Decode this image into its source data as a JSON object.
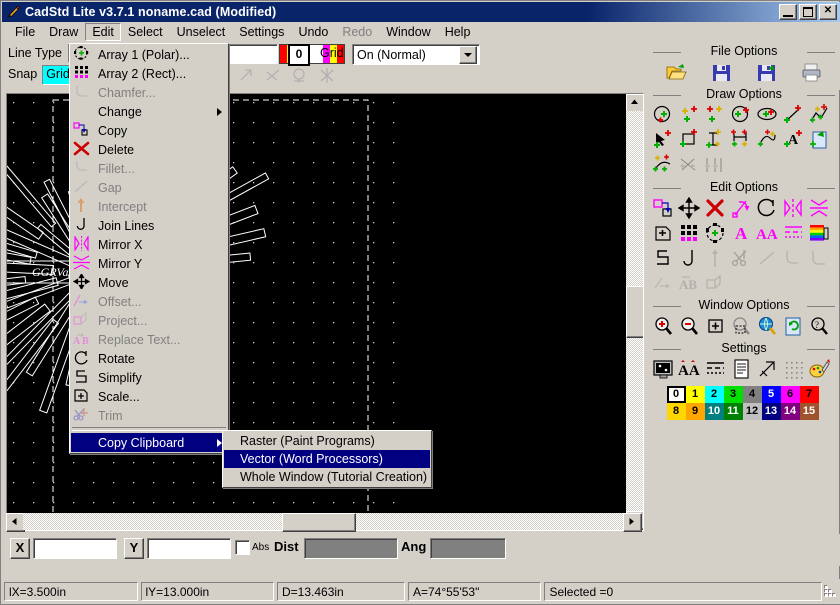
{
  "window": {
    "title": "CadStd Lite v3.7.1  noname.cad  (Modified)",
    "icon": "pencil-icon",
    "minimize_label": "_",
    "maximize_label": "",
    "close_label": "✕"
  },
  "menubar": {
    "items": [
      {
        "label": "File",
        "state": "normal"
      },
      {
        "label": "Draw",
        "state": "normal"
      },
      {
        "label": "Edit",
        "state": "active"
      },
      {
        "label": "Select",
        "state": "normal"
      },
      {
        "label": "Unselect",
        "state": "normal"
      },
      {
        "label": "Settings",
        "state": "normal"
      },
      {
        "label": "Undo",
        "state": "normal"
      },
      {
        "label": "Redo",
        "state": "disabled"
      },
      {
        "label": "Window",
        "state": "normal"
      },
      {
        "label": "Help",
        "state": "normal"
      }
    ]
  },
  "toolbar": {
    "line_type_label": "Line Type",
    "line_type_value": "",
    "snap_label": "Snap",
    "snap_value": "Grid",
    "width_value": "",
    "color_index": "0",
    "grid_label": "Grid",
    "grid_value": "On (Normal)"
  },
  "edit_menu": {
    "items": [
      {
        "label": "Array 1 (Polar)...",
        "icon": "array-polar-icon",
        "state": "normal"
      },
      {
        "label": "Array 2 (Rect)...",
        "icon": "array-rect-icon",
        "state": "normal"
      },
      {
        "label": "Chamfer...",
        "icon": "chamfer-icon",
        "state": "disabled"
      },
      {
        "label": "Change",
        "icon": "none",
        "state": "normal",
        "submenu": true
      },
      {
        "label": "Copy",
        "icon": "copy-icon",
        "state": "normal"
      },
      {
        "label": "Delete",
        "icon": "delete-icon",
        "state": "normal"
      },
      {
        "label": "Fillet...",
        "icon": "fillet-icon",
        "state": "disabled"
      },
      {
        "label": "Gap",
        "icon": "gap-icon",
        "state": "disabled"
      },
      {
        "label": "Intercept",
        "icon": "intercept-icon",
        "state": "disabled"
      },
      {
        "label": "Join Lines",
        "icon": "join-lines-icon",
        "state": "normal"
      },
      {
        "label": "Mirror X",
        "icon": "mirror-x-icon",
        "state": "normal"
      },
      {
        "label": "Mirror Y",
        "icon": "mirror-y-icon",
        "state": "normal"
      },
      {
        "label": "Move",
        "icon": "move-icon",
        "state": "normal"
      },
      {
        "label": "Offset...",
        "icon": "offset-icon",
        "state": "disabled"
      },
      {
        "label": "Project...",
        "icon": "project-icon",
        "state": "disabled"
      },
      {
        "label": "Replace Text...",
        "icon": "replace-text-icon",
        "state": "disabled"
      },
      {
        "label": "Rotate",
        "icon": "rotate-icon",
        "state": "normal"
      },
      {
        "label": "Simplify",
        "icon": "simplify-icon",
        "state": "normal"
      },
      {
        "label": "Scale...",
        "icon": "scale-icon",
        "state": "normal"
      },
      {
        "label": "Trim",
        "icon": "trim-icon",
        "state": "disabled"
      },
      {
        "label": "Copy Clipboard",
        "icon": "none",
        "state": "selected",
        "submenu": true
      }
    ]
  },
  "clipboard_submenu": {
    "items": [
      {
        "label": "Raster (Paint Programs)",
        "state": "normal"
      },
      {
        "label": "Vector (Word Processors)",
        "state": "selected"
      },
      {
        "label": "Whole Window (Tutorial Creation)",
        "state": "normal"
      }
    ]
  },
  "right_panel": {
    "file_options": {
      "title": "File Options",
      "icons": [
        "open-folder-icon",
        "save-icon",
        "save-as-icon",
        "print-icon"
      ]
    },
    "draw_options": {
      "title": "Draw Options",
      "icons": [
        "circle-center-icon",
        "arc-3point-icon",
        "arc-icon",
        "circle-2point-icon",
        "ellipse-icon",
        "line-icon",
        "polyline-icon",
        "pointer-icon",
        "rectangle-icon",
        "dimension-vertical-icon",
        "dimension-horizontal-icon",
        "spline-icon",
        "text-icon",
        "insert-file-icon",
        "curve-icon",
        "trim-draw-icon",
        "extend-draw-icon"
      ]
    },
    "edit_options": {
      "title": "Edit Options",
      "icons": [
        "copy-icon",
        "move-icon",
        "delete-icon",
        "rotate-node-icon",
        "rotate-icon",
        "mirror-x-icon",
        "mirror-y-icon",
        "scale-icon",
        "array-rect-icon",
        "array-polar-icon",
        "text-edit-icon",
        "replace-text-icon",
        "line-type-icon",
        "color-change-icon",
        "simplify-icon",
        "join-lines-icon",
        "intercept-icon",
        "trim-icon",
        "gap-icon",
        "fillet-icon",
        "chamfer-icon",
        "offset-icon",
        "replace-text2-icon",
        "project-icon"
      ]
    },
    "window_options": {
      "title": "Window Options",
      "icons": [
        "zoom-in-icon",
        "zoom-out-icon",
        "zoom-extents-icon",
        "zoom-window-icon",
        "zoom-all-icon",
        "redraw-icon",
        "zoom-help-icon"
      ]
    },
    "settings": {
      "title": "Settings",
      "icons": [
        "display-settings-icon",
        "text-settings-icon",
        "line-settings-icon",
        "page-settings-icon",
        "dimension-settings-icon",
        "grid-settings-icon",
        "color-settings-icon"
      ]
    },
    "palette": {
      "selected": "0",
      "cells": [
        {
          "n": "0",
          "hex": "#ffffff",
          "fg": "#000000"
        },
        {
          "n": "1",
          "hex": "#ffff00",
          "fg": "#000000"
        },
        {
          "n": "2",
          "hex": "#00ffff",
          "fg": "#000000"
        },
        {
          "n": "3",
          "hex": "#00e000",
          "fg": "#000000"
        },
        {
          "n": "4",
          "hex": "#808080",
          "fg": "#000000"
        },
        {
          "n": "5",
          "hex": "#0000ff",
          "fg": "#ffffff"
        },
        {
          "n": "6",
          "hex": "#ff00ff",
          "fg": "#000000"
        },
        {
          "n": "7",
          "hex": "#ff0000",
          "fg": "#000000"
        },
        {
          "n": "8",
          "hex": "#ffd700",
          "fg": "#000000"
        },
        {
          "n": "9",
          "hex": "#ffa500",
          "fg": "#000000"
        },
        {
          "n": "10",
          "hex": "#008080",
          "fg": "#ffffff"
        },
        {
          "n": "11",
          "hex": "#008000",
          "fg": "#ffffff"
        },
        {
          "n": "12",
          "hex": "#c0c0c0",
          "fg": "#000000"
        },
        {
          "n": "13",
          "hex": "#000080",
          "fg": "#ffffff"
        },
        {
          "n": "14",
          "hex": "#800080",
          "fg": "#ffffff"
        },
        {
          "n": "15",
          "hex": "#a0522d",
          "fg": "#ffffff"
        }
      ]
    }
  },
  "coordbar": {
    "x_label": "X",
    "x_value": "",
    "y_label": "Y",
    "y_value": "",
    "abs_label": "Abs",
    "abs_checked": false,
    "dist_label": "Dist",
    "dist_value": "",
    "ang_label": "Ang",
    "ang_value": ""
  },
  "statusbar": {
    "panes": [
      "lX=3.500in",
      "lY=13.000in",
      "D=13.463in",
      "A=74°55'53\"",
      "Selected =0"
    ]
  },
  "drawing": {
    "label_text": "GGRVa Davis",
    "background": "#000000",
    "stroke": "#ffffff"
  }
}
